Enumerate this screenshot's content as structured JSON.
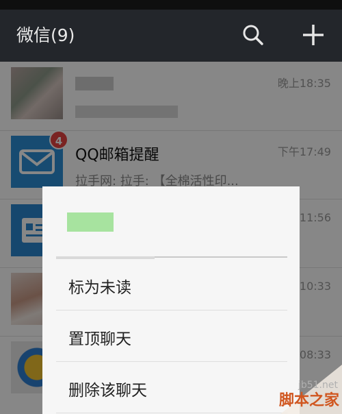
{
  "app": {
    "title": "微信(9)"
  },
  "chats": [
    {
      "name": "",
      "time": "晚上18:35",
      "preview": ""
    },
    {
      "name": "QQ邮箱提醒",
      "time": "下午17:49",
      "preview": "拉手网: 拉手: 【全棉活性印...",
      "badge": "4"
    },
    {
      "name": "",
      "time": "11:56",
      "preview": ""
    },
    {
      "name": "",
      "time": "10:33",
      "preview": ""
    },
    {
      "name": "",
      "time": "08:33",
      "preview": ""
    }
  ],
  "menu": {
    "items": [
      "标为未读",
      "置顶聊天",
      "删除该聊天"
    ]
  },
  "watermark": {
    "site": "jb51.net",
    "name": "脚本之家"
  },
  "colors": {
    "appbar": "#23262b",
    "badge": "#e64340",
    "mail_icon": "#2c8fd6"
  }
}
